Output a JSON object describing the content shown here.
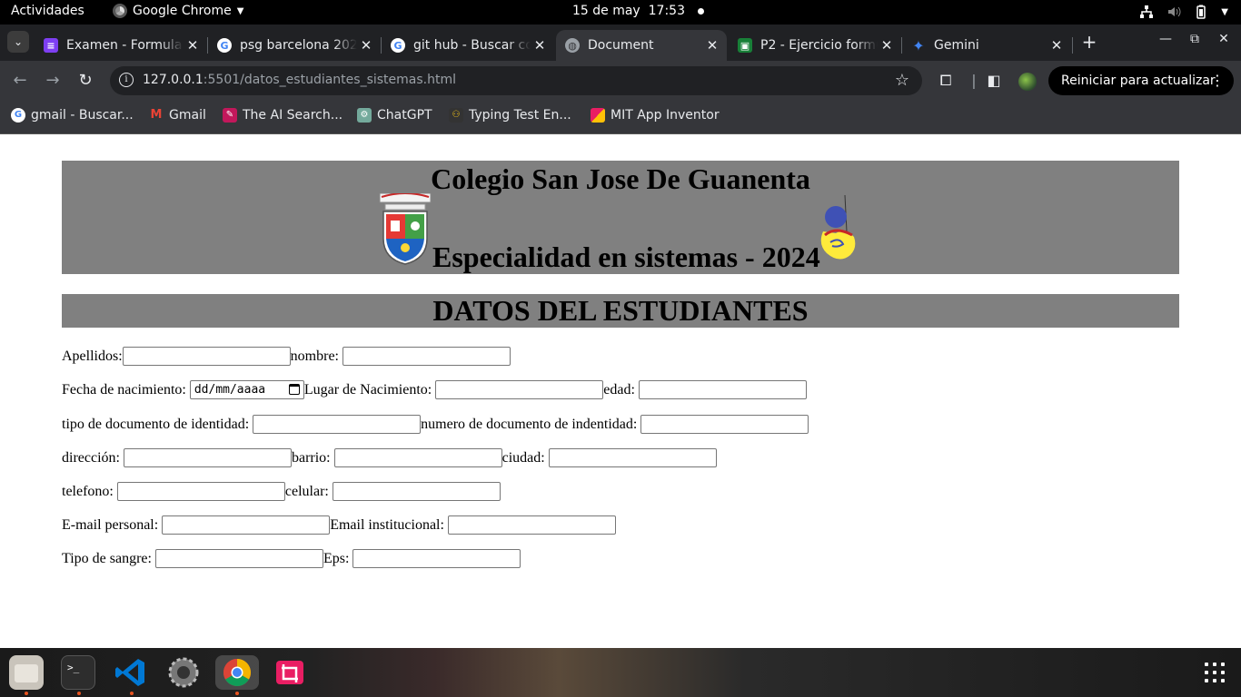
{
  "gnome": {
    "activities": "Actividades",
    "app_name": "Google Chrome",
    "date": "15 de may",
    "time": "17:53"
  },
  "tabs": [
    {
      "title": "Examen - Formula",
      "favicon": "forms-icon",
      "color": "#7e3ff2"
    },
    {
      "title": "psg barcelona 2024",
      "favicon": "google-icon",
      "color": "#4285f4"
    },
    {
      "title": "git hub - Buscar con",
      "favicon": "google-icon",
      "color": "#4285f4"
    },
    {
      "title": "Document",
      "favicon": "globe-icon",
      "color": "#9aa0a6",
      "active": true
    },
    {
      "title": "P2 - Ejercicio formu",
      "favicon": "classroom-icon",
      "color": "#188038"
    },
    {
      "title": "Gemini",
      "favicon": "gemini-icon",
      "color": "#4285f4"
    }
  ],
  "toolbar": {
    "url_host": "127.0.0.1",
    "url_path": ":5501/datos_estudiantes_sistemas.html",
    "restart_label": "Reiniciar para actualizar"
  },
  "bookmarks": [
    {
      "label": "gmail - Buscar...",
      "icon": "google-icon"
    },
    {
      "label": "Gmail",
      "icon": "gmail-icon"
    },
    {
      "label": "The AI Search...",
      "icon": "ai-search-icon"
    },
    {
      "label": "ChatGPT",
      "icon": "chatgpt-icon"
    },
    {
      "label": "Typing Test En...",
      "icon": "typing-test-icon"
    },
    {
      "label": "MIT App Inventor",
      "icon": "app-inventor-icon"
    }
  ],
  "page": {
    "school_name": "Colegio San Jose De Guanenta",
    "specialty": "Especialidad en sistemas - 2024",
    "section_title": "DATOS DEL ESTUDIANTES",
    "date_placeholder": "dd/mm/aaaa",
    "labels": {
      "apellidos": "Apellidos:",
      "nombre": "nombre:",
      "fecha_nacimiento": "Fecha de nacimiento:",
      "lugar_nacimiento": "Lugar de Nacimiento:",
      "edad": "edad:",
      "tipo_documento": "tipo de documento de identidad:",
      "numero_documento": "numero de documento de indentidad:",
      "direccion": "dirección:",
      "barrio": "barrio:",
      "ciudad": "ciudad:",
      "telefono": "telefono:",
      "celular": "celular:",
      "email_personal": "E-mail personal:",
      "email_institucional": "Email institucional:",
      "tipo_sangre": "Tipo de sangre:",
      "eps": "Eps:"
    }
  }
}
